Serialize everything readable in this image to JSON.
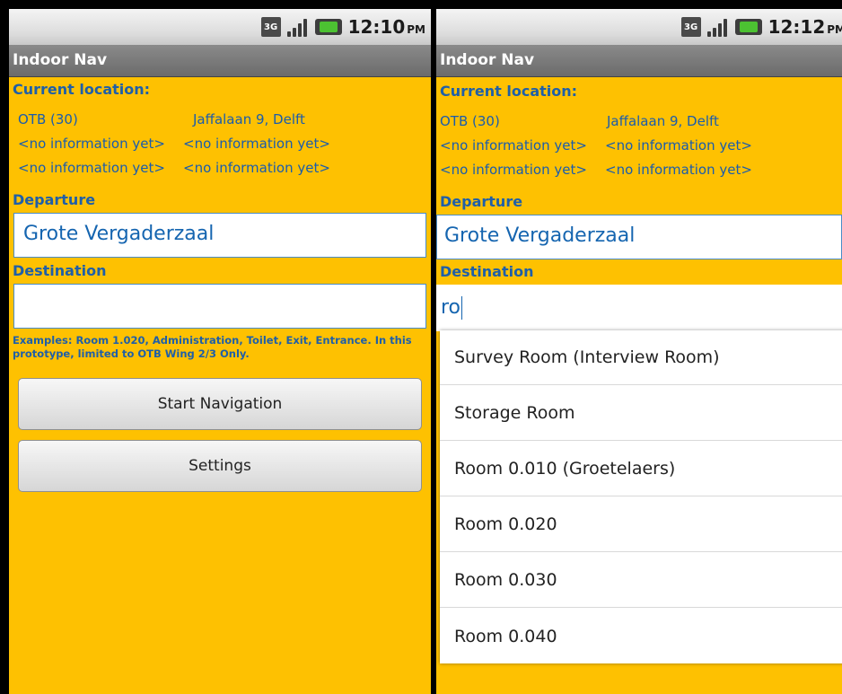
{
  "left": {
    "status": {
      "clock": "12:10",
      "ampm": "PM",
      "network": "3G"
    },
    "title": "Indoor Nav",
    "current_location_label": "Current location:",
    "location_rows": [
      [
        "OTB (30)",
        "Jaffalaan 9, Delft"
      ],
      [
        "<no information yet>",
        "<no information yet>"
      ],
      [
        "<no information yet>",
        "<no information yet>"
      ]
    ],
    "departure_label": "Departure",
    "departure_value": "Grote Vergaderzaal",
    "destination_label": "Destination",
    "destination_value": "",
    "help_text": "Examples: Room 1.020, Administration, Toilet, Exit, Entrance. In this prototype, limited to OTB Wing 2/3 Only.",
    "start_button": "Start Navigation",
    "settings_button": "Settings"
  },
  "right": {
    "status": {
      "clock": "12:12",
      "ampm": "PM",
      "network": "3G"
    },
    "title": "Indoor Nav",
    "current_location_label": "Current location:",
    "location_rows": [
      [
        "OTB (30)",
        "Jaffalaan 9, Delft"
      ],
      [
        "<no information yet>",
        "<no information yet>"
      ],
      [
        "<no information yet>",
        "<no information yet>"
      ]
    ],
    "departure_label": "Departure",
    "departure_value": "Grote Vergaderzaal",
    "destination_label": "Destination",
    "destination_value": "ro",
    "suggestions": [
      "Survey Room (Interview Room)",
      "Storage Room",
      "Room 0.010 (Groetelaers)",
      "Room 0.020",
      "Room 0.030",
      "Room 0.040"
    ]
  }
}
